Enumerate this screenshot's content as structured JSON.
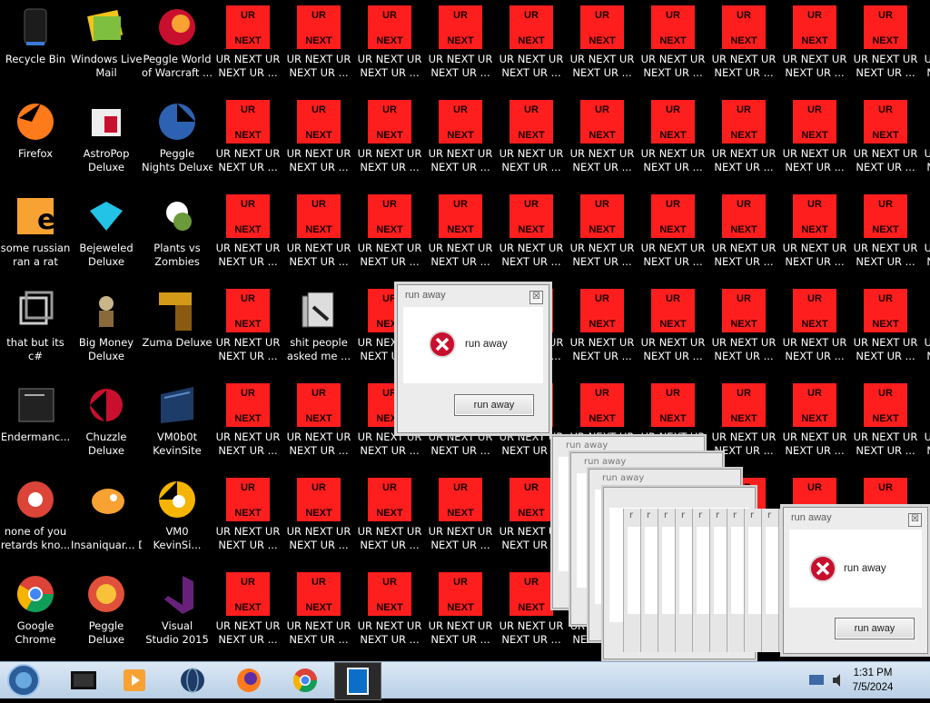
{
  "desktop_icons": [
    {
      "label": "Recycle Bin",
      "icon": "recycle-bin-icon"
    },
    {
      "label": "Windows Live Mail",
      "icon": "windows-live-mail-icon"
    },
    {
      "label": "Peggle World of Warcraft ...",
      "icon": "peggle-wow-icon"
    },
    {
      "label": "Firefox",
      "icon": "firefox-icon"
    },
    {
      "label": "AstroPop Deluxe",
      "icon": "astropop-icon"
    },
    {
      "label": "Peggle Nights Deluxe",
      "icon": "peggle-nights-icon"
    },
    {
      "label": "some russian ran a rat",
      "icon": "russian-rat-icon"
    },
    {
      "label": "Bejeweled Deluxe",
      "icon": "bejeweled-icon"
    },
    {
      "label": "Plants vs Zombies",
      "icon": "plants-vs-zombies-icon"
    },
    {
      "label": "that but its c#",
      "icon": "csharp-shortcut-icon"
    },
    {
      "label": "Big Money Deluxe",
      "icon": "big-money-icon"
    },
    {
      "label": "Zuma Deluxe",
      "icon": "zuma-icon"
    },
    {
      "label": "Endermanc...",
      "icon": "enderman-icon"
    },
    {
      "label": "Chuzzle Deluxe",
      "icon": "chuzzle-icon"
    },
    {
      "label": "VM0b0t KevinSite",
      "icon": "vm0b0t-icon"
    },
    {
      "label": "none of you retards kno...",
      "icon": "chrome-shortcut-icon"
    },
    {
      "label": "Insaniquar... Deluxe",
      "icon": "insaniquarium-icon"
    },
    {
      "label": "VM0 KevinSi...",
      "icon": "vm0-kevinsite-icon"
    },
    {
      "label": "Google Chrome",
      "icon": "chrome-icon"
    },
    {
      "label": "Peggle Deluxe",
      "icon": "peggle-icon"
    },
    {
      "label": "Visual Studio 2015",
      "icon": "visual-studio-icon"
    }
  ],
  "folder_icon": {
    "label": "shit people asked me ...",
    "icon": "folder-icon"
  },
  "ur_icon": {
    "top": "UR",
    "bottom": "NEXT",
    "label": "UR NEXT UR NEXT UR ..."
  },
  "dialog_main": {
    "title": "run away",
    "message": "run away",
    "button": "run away",
    "close": "☒"
  },
  "dialog_front": {
    "title": "run away",
    "message": "run away",
    "button": "run away",
    "close": "☒"
  },
  "ghost_titles": {
    "a": "run away",
    "b": "run away",
    "c": "run away"
  },
  "stripe_letters": [
    "r",
    "r",
    "r",
    "r",
    "r",
    "r",
    "r",
    "r",
    "r",
    "r"
  ],
  "taskbar": {
    "items": [
      "start-orb-icon",
      "media-center-icon",
      "media-player-icon",
      "globe-icon",
      "firefox-icon",
      "chrome-icon",
      "app-window-icon"
    ],
    "time": "1:31 PM",
    "date": "7/5/2024"
  },
  "colors": {
    "ur_red": "#ff1e1e",
    "desktop_bg": "#000000",
    "taskbar": "#c8dbee"
  }
}
